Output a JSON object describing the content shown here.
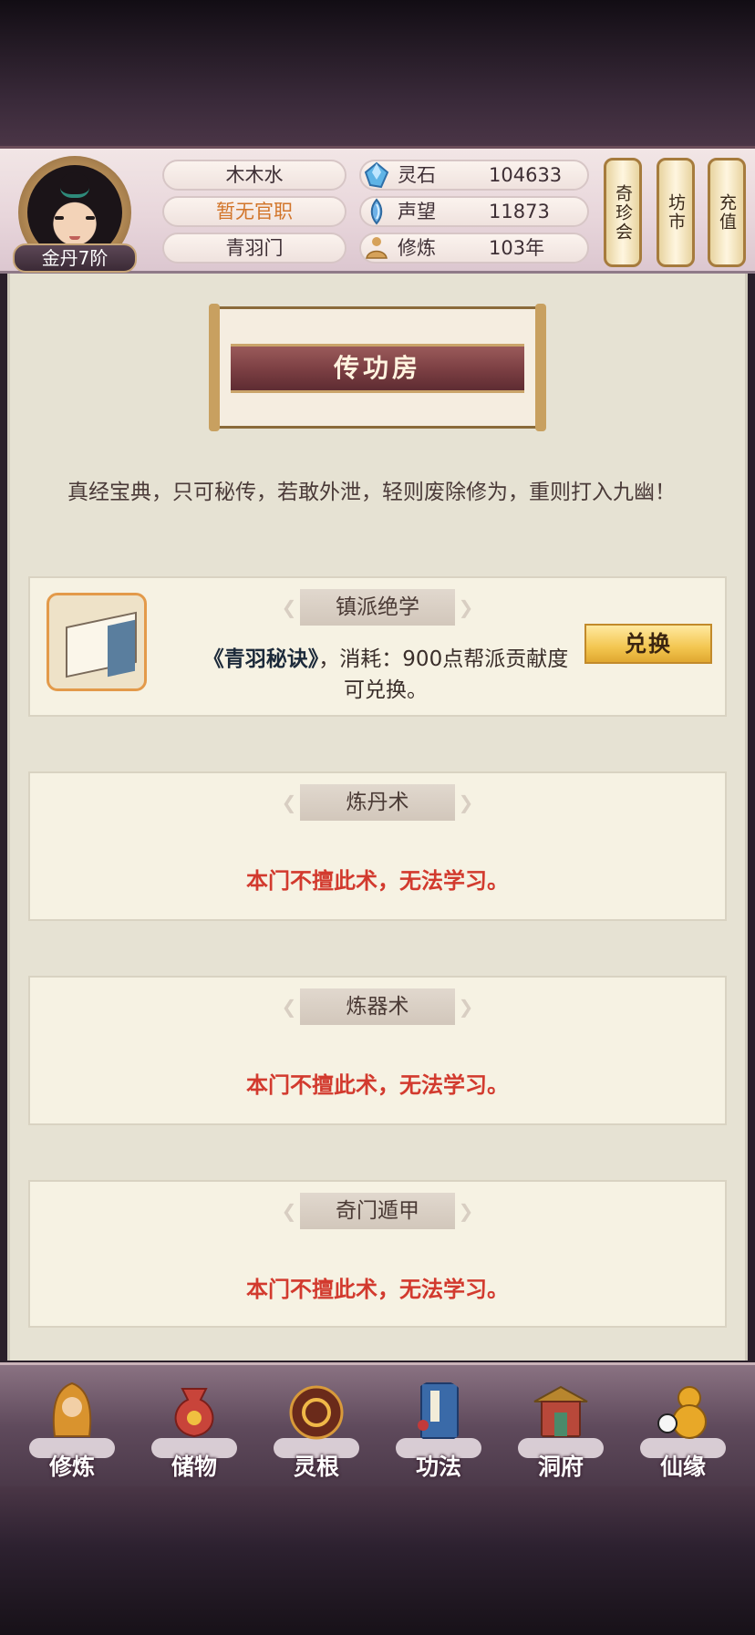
{
  "header": {
    "player_name": "木木水",
    "official_title": "暂无官职",
    "sect": "青羽门",
    "rank_badge": "金丹7阶",
    "resources": [
      {
        "icon": "spirit-stone-icon",
        "name": "灵石",
        "value": "104633"
      },
      {
        "icon": "prestige-icon",
        "name": "声望",
        "value": "11873"
      },
      {
        "icon": "cultivation-icon",
        "name": "修炼",
        "value": "103年"
      }
    ],
    "scroll_buttons": [
      "奇珍会",
      "坊市",
      "充值"
    ]
  },
  "page": {
    "title": "传功房",
    "description": "真经宝典，只可秘传，若敢外泄，轻则废除修为，重则打入九幽！"
  },
  "cards": [
    {
      "tag": "镇派绝学",
      "book_name": "《青羽秘诀》",
      "text_rest": "，消耗：900点帮派贡献度可兑换。",
      "button": "兑换"
    },
    {
      "tag": "炼丹术",
      "message": "本门不擅此术，无法学习。"
    },
    {
      "tag": "炼器术",
      "message": "本门不擅此术，无法学习。"
    },
    {
      "tag": "奇门遁甲",
      "message": "本门不擅此术，无法学习。"
    }
  ],
  "nav": [
    {
      "label": "修炼",
      "icon": "monk-icon"
    },
    {
      "label": "储物",
      "icon": "bag-icon"
    },
    {
      "label": "灵根",
      "icon": "spirit-root-icon"
    },
    {
      "label": "功法",
      "icon": "scripture-icon"
    },
    {
      "label": "洞府",
      "icon": "cave-palace-icon"
    },
    {
      "label": "仙缘",
      "icon": "gourd-icon"
    }
  ],
  "colors": {
    "warning": "#d23a2e",
    "accent_gold": "#f3c650",
    "title_ribbon": "#7a3e42"
  }
}
